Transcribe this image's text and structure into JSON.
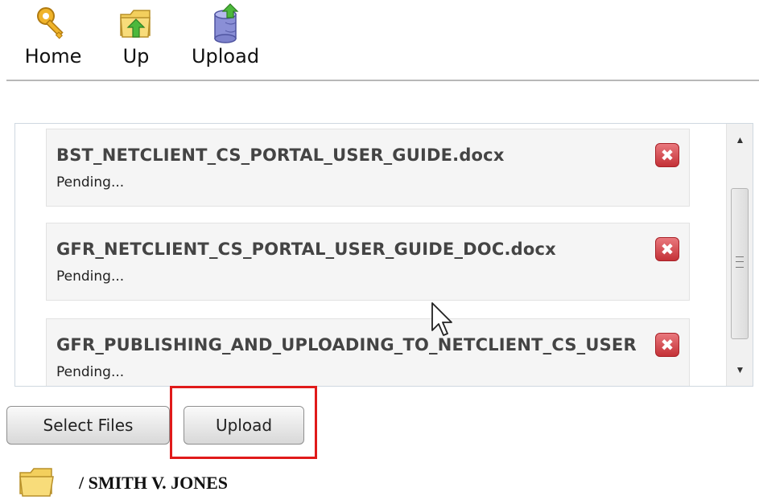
{
  "toolbar": {
    "home_label": "Home",
    "up_label": "Up",
    "upload_label": "Upload"
  },
  "queue": {
    "items": [
      {
        "name": "BST_NETCLIENT_CS_PORTAL_USER_GUIDE.docx",
        "status": "Pending..."
      },
      {
        "name": "GFR_NETCLIENT_CS_PORTAL_USER_GUIDE_DOC.docx",
        "status": "Pending..."
      },
      {
        "name": "GFR_PUBLISHING_AND_UPLOADING_TO_NETCLIENT_CS_USER",
        "status": "Pending..."
      }
    ],
    "remove_glyph": "✖"
  },
  "actions": {
    "select_files_label": "Select Files",
    "upload_label": "Upload"
  },
  "path": {
    "current": "/ SMITH V. JONES"
  },
  "colors": {
    "highlight": "#e01a1a",
    "remove": "#c43137"
  },
  "icons": {
    "home": "key-icon",
    "up": "folder-up-icon",
    "upload": "database-upload-icon",
    "folder": "folder-icon"
  }
}
